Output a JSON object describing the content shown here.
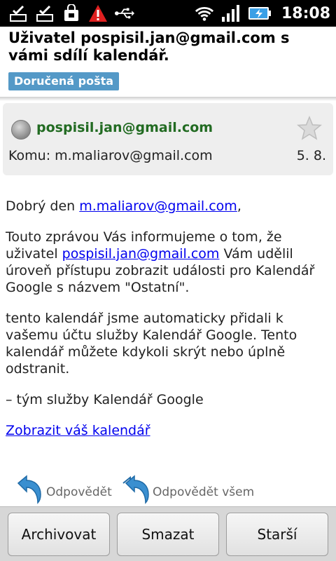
{
  "status_bar": {
    "time": "18:08",
    "icons": [
      "check-notification-icon",
      "check-notification-icon",
      "shopping-bag-icon",
      "warning-icon",
      "usb-icon",
      "wifi-icon",
      "signal-icon",
      "battery-charging-icon"
    ],
    "warning_color": "#e02020"
  },
  "header": {
    "subject": "Uživatel pospisil.jan@gmail.com s vámi sdílí kalendář.",
    "label": "Doručená pošta",
    "label_color": "#5499c7"
  },
  "sender_card": {
    "sender": "pospisil.jan@gmail.com",
    "sender_color": "#226b22",
    "to_line": "Komu: m.maliarov@gmail.com",
    "date": "5. 8."
  },
  "body": {
    "greeting_prefix": "Dobrý den ",
    "greeting_link": "m.maliarov@gmail.com",
    "greeting_suffix": ",",
    "p1_prefix": "Touto zprávou Vás informujeme o tom, že uživatel ",
    "p1_link": "pospisil.jan@gmail.com",
    "p1_suffix": " Vám udělil úroveň přístupu zobrazit události pro Kalendář Google s názvem \"Ostatní\".",
    "p2": "tento kalendář jsme automaticky přidali k vašemu účtu služby Kalendář Google. Tento kalendář můžete kdykoli skrýt nebo úplně odstranit.",
    "signature": "– tým služby Kalendář Google",
    "calendar_link": "Zobrazit váš kalendář"
  },
  "reply": {
    "reply_label": "Odpovědět",
    "reply_all_label": "Odpovědět všem"
  },
  "bottom_bar": {
    "archive_label": "Archivovat",
    "delete_label": "Smazat",
    "older_label": "Starší"
  }
}
